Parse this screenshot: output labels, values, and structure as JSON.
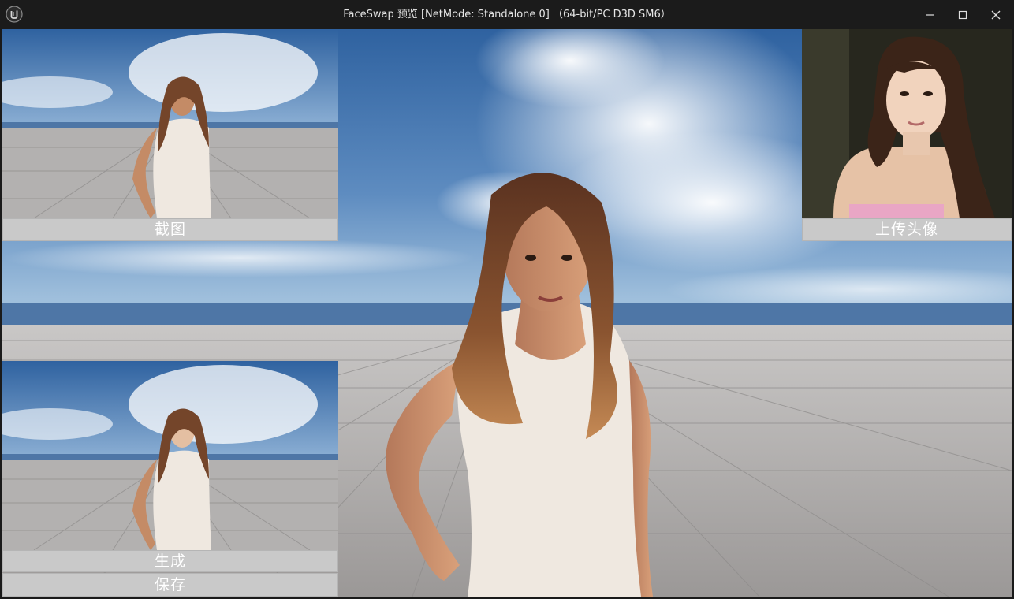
{
  "window": {
    "title": "FaceSwap 预览 [NetMode: Standalone 0]  （64-bit/PC D3D SM6）"
  },
  "icons": {
    "app": "unreal-engine-logo-icon",
    "minimize": "minimize-icon",
    "maximize": "maximize-icon",
    "close": "close-icon"
  },
  "colors": {
    "titlebar": "#1b1b1b",
    "button_bg": "#c9c9c9",
    "button_text": "#ffffff",
    "sky_top": "#3c6ea8",
    "floor": "#a9a7a6"
  },
  "buttons": {
    "screenshot": "截图",
    "upload_avatar": "上传头像",
    "generate": "生成",
    "save": "保存"
  },
  "images": {
    "main_view": "3d-character-main-view",
    "capture_preview": "captured-screenshot-thumbnail",
    "generated_preview": "generated-result-thumbnail",
    "avatar": "uploaded-avatar-photo"
  }
}
